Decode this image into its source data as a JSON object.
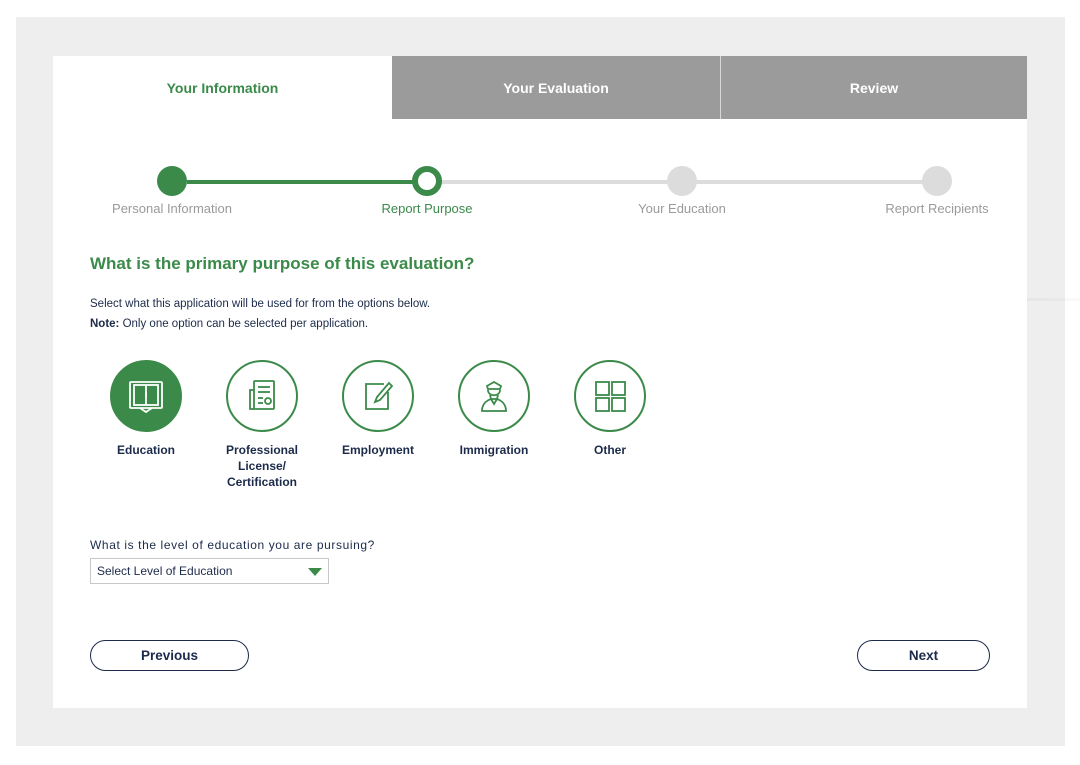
{
  "tabs": [
    {
      "label": "Your Information",
      "active": true
    },
    {
      "label": "Your Evaluation",
      "active": false
    },
    {
      "label": "Review",
      "active": false
    }
  ],
  "steps": [
    {
      "label": "Personal Information",
      "state": "done"
    },
    {
      "label": "Report Purpose",
      "state": "current"
    },
    {
      "label": "Your Education",
      "state": "todo"
    },
    {
      "label": "Report Recipients",
      "state": "todo"
    }
  ],
  "question": "What is the primary purpose of this evaluation?",
  "description": {
    "line1": "Select what this application will be used for from the options below.",
    "note_label": "Note:",
    "note_text": " Only one option can be selected per application."
  },
  "options": [
    {
      "label": "Education",
      "icon": "book-icon",
      "selected": true
    },
    {
      "label": "Professional License/ Certification",
      "icon": "certificate-icon",
      "selected": false
    },
    {
      "label": "Employment",
      "icon": "pencil-edit-icon",
      "selected": false
    },
    {
      "label": "Immigration",
      "icon": "officer-icon",
      "selected": false
    },
    {
      "label": "Other",
      "icon": "grid-icon",
      "selected": false
    }
  ],
  "education_level": {
    "question": "What is the level of education you are pursuing?",
    "selected": "Select Level of Education"
  },
  "buttons": {
    "previous": "Previous",
    "next": "Next"
  },
  "colors": {
    "accent": "#3b8a4a",
    "navy": "#1c2b4a",
    "tab_inactive": "#9b9b9b"
  }
}
